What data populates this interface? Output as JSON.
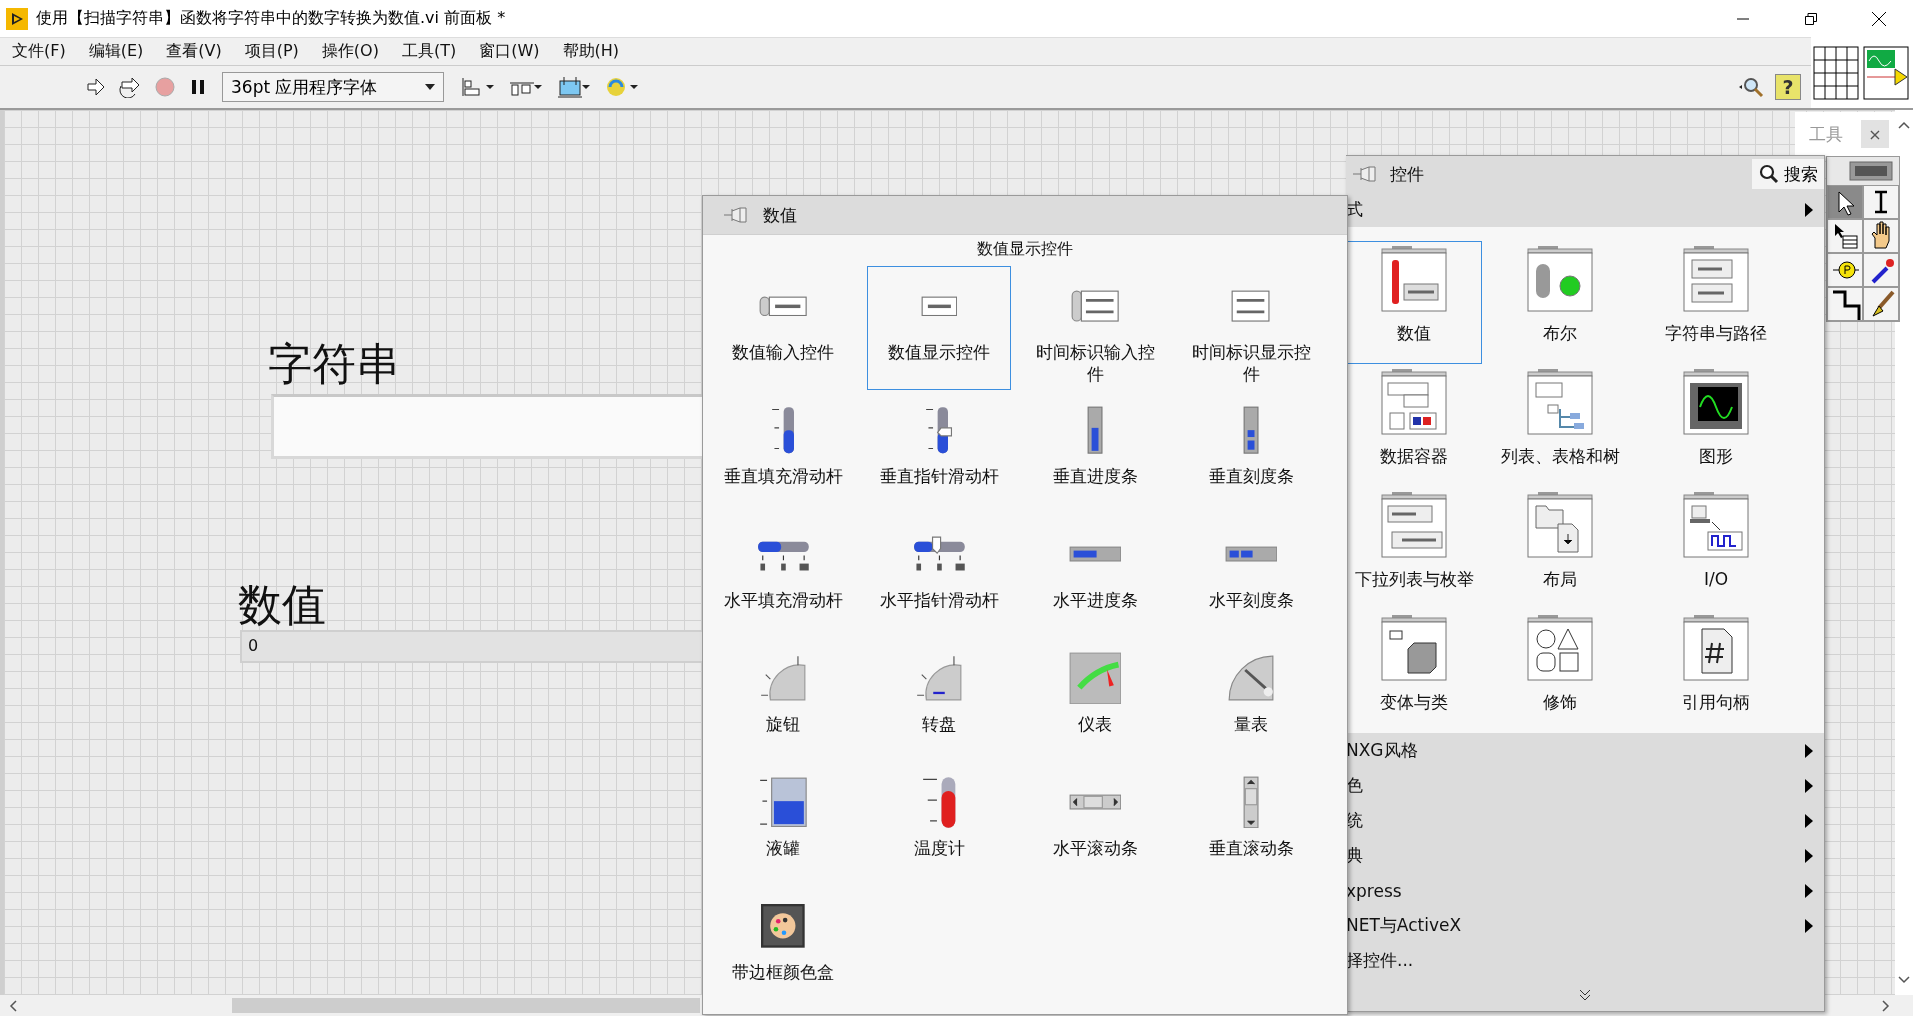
{
  "window": {
    "title": "使用【扫描字符串】函数将字符串中的数字转换为数值.vi 前面板 *"
  },
  "menu": [
    "文件(F)",
    "编辑(E)",
    "查看(V)",
    "项目(P)",
    "操作(O)",
    "工具(T)",
    "窗口(W)",
    "帮助(H)"
  ],
  "toolbar": {
    "font": "36pt 应用程序字体",
    "help": "?"
  },
  "front_panel": {
    "controls": [
      {
        "kind": "string",
        "label": "字符串"
      },
      {
        "kind": "numeric",
        "label": "数值",
        "value": "0"
      }
    ]
  },
  "numeric_palette": {
    "title": "数值",
    "hover_label": "数值显示控件",
    "items": [
      {
        "label": "数值输入控件",
        "selected": false
      },
      {
        "label": "数值显示控件",
        "selected": true
      },
      {
        "label": "时间标识输入控件",
        "selected": false
      },
      {
        "label": "时间标识显示控件",
        "selected": false
      },
      {
        "label": "垂直填充滑动杆",
        "selected": false
      },
      {
        "label": "垂直指针滑动杆",
        "selected": false
      },
      {
        "label": "垂直进度条",
        "selected": false
      },
      {
        "label": "垂直刻度条",
        "selected": false
      },
      {
        "label": "水平填充滑动杆",
        "selected": false
      },
      {
        "label": "水平指针滑动杆",
        "selected": false
      },
      {
        "label": "水平进度条",
        "selected": false
      },
      {
        "label": "水平刻度条",
        "selected": false
      },
      {
        "label": "旋钮",
        "selected": false
      },
      {
        "label": "转盘",
        "selected": false
      },
      {
        "label": "仪表",
        "selected": false
      },
      {
        "label": "量表",
        "selected": false
      },
      {
        "label": "液罐",
        "selected": false
      },
      {
        "label": "温度计",
        "selected": false
      },
      {
        "label": "水平滚动条",
        "selected": false
      },
      {
        "label": "垂直滚动条",
        "selected": false
      },
      {
        "label": "带边框颜色盒",
        "selected": false
      }
    ]
  },
  "controls_palette": {
    "title": "控件",
    "search": "搜索",
    "categories": [
      {
        "label": "式",
        "kind": "submenu",
        "items": [
          {
            "label": "数值",
            "selected": true
          },
          {
            "label": "布尔",
            "selected": false
          },
          {
            "label": "字符串与路径",
            "selected": false
          },
          {
            "label": "数据容器",
            "selected": false
          },
          {
            "label": "列表、表格和树",
            "selected": false
          },
          {
            "label": "图形",
            "selected": false
          },
          {
            "label": "下拉列表与枚举",
            "selected": false
          },
          {
            "label": "布局",
            "selected": false
          },
          {
            "label": "I/O",
            "selected": false
          },
          {
            "label": "变体与类",
            "selected": false
          },
          {
            "label": "修饰",
            "selected": false
          },
          {
            "label": "引用句柄",
            "selected": false
          }
        ]
      },
      {
        "label": "NXG风格",
        "kind": "submenu"
      },
      {
        "label": "色",
        "kind": "submenu"
      },
      {
        "label": "统",
        "kind": "submenu"
      },
      {
        "label": "典",
        "kind": "submenu"
      },
      {
        "label": "xpress",
        "kind": "submenu"
      },
      {
        "label": "NET与ActiveX",
        "kind": "submenu"
      },
      {
        "label": "择控件...",
        "kind": "command"
      }
    ]
  },
  "tools_palette": {
    "title": "工具",
    "close": "×",
    "tools": [
      {
        "selected": true
      },
      {
        "selected": false
      },
      {
        "selected": false
      },
      {
        "selected": false
      },
      {
        "selected": false
      },
      {
        "selected": false
      },
      {
        "selected": false
      },
      {
        "selected": false
      }
    ]
  }
}
